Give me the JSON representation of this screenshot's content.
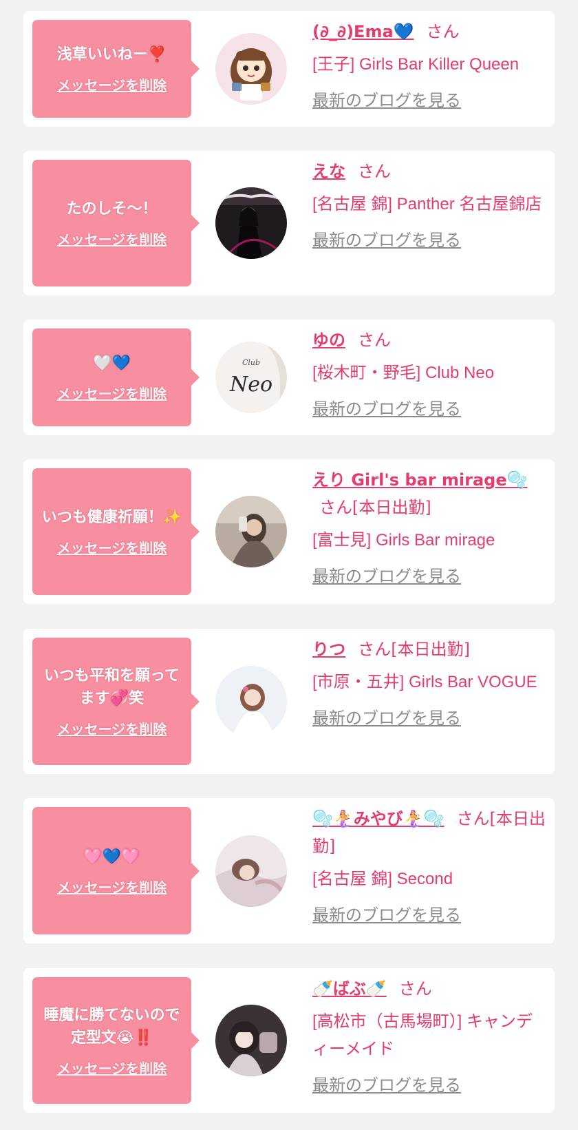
{
  "colors": {
    "page_bg": "#f2f2f2",
    "card_bg": "#ffffff",
    "bubble_bg": "#f78fa0",
    "accent": "#e33d6e",
    "muted_link": "#8c8c8c"
  },
  "items": [
    {
      "message": "浅草いいねー❣️",
      "delete_label": "メッセージを削除",
      "name": "(∂_∂)Ema💙",
      "honorific": "さん",
      "shop": "[王子] Girls Bar Killer Queen",
      "blog_label": "最新のブログを見る",
      "avatar_icon": "cartoon-girl-avatar"
    },
    {
      "message": "たのしそ〜！",
      "delete_label": "メッセージを削除",
      "name": "えな",
      "honorific": "さん",
      "shop": "[名古屋 錦] Panther 名古屋錦店",
      "blog_label": "最新のブログを見る",
      "avatar_icon": "panther-photo-avatar"
    },
    {
      "message": "🤍💙",
      "delete_label": "メッセージを削除",
      "name": "ゆの",
      "honorific": "さん",
      "shop": "[桜木町・野毛] Club Neo",
      "blog_label": "最新のブログを見る",
      "avatar_icon": "club-neo-logo-avatar",
      "avatar_text": [
        "Club",
        "Neo"
      ]
    },
    {
      "message": "いつも健康祈願！✨",
      "delete_label": "メッセージを削除",
      "name": "えり Girl's bar mirage🫧",
      "honorific": "さん[本日出勤]",
      "shop": "[富士見] Girls Bar mirage",
      "blog_label": "最新のブログを見る",
      "avatar_icon": "mirror-selfie-avatar"
    },
    {
      "message": "いつも平和を願ってます💞笑",
      "delete_label": "メッセージを削除",
      "name": "りつ",
      "honorific": "さん[本日出勤]",
      "shop": "[市原・五井] Girls Bar VOGUE",
      "blog_label": "最新のブログを見る",
      "avatar_icon": "portrait-photo-avatar"
    },
    {
      "message": "🩷💙🩷",
      "delete_label": "メッセージを削除",
      "name": "🫧🧜‍♀️みやび🧜‍♀️🫧",
      "honorific": "さん[本日出勤]",
      "shop": "[名古屋 錦] Second",
      "blog_label": "最新のブログを見る",
      "avatar_icon": "soft-photo-avatar"
    },
    {
      "message": "睡魔に勝てないので定型文😭‼️",
      "delete_label": "メッセージを削除",
      "name": "🍼ばぶ🍼",
      "honorific": "さん",
      "shop": "[高松市（古馬場町）] キャンディーメイド",
      "blog_label": "最新のブログを見る",
      "avatar_icon": "selfie-photo-avatar"
    }
  ]
}
